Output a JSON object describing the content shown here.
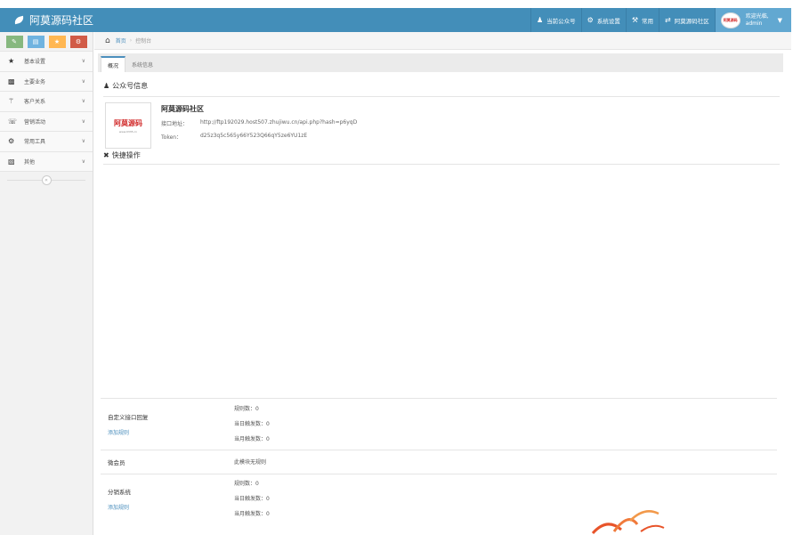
{
  "header": {
    "brand": "阿莫源码社区",
    "nav": [
      {
        "icon": "user-icon",
        "label": "当前公众号"
      },
      {
        "icon": "gear-icon",
        "label": "系统设置"
      },
      {
        "icon": "wrench-icon",
        "label": "常用"
      },
      {
        "icon": "exchange-icon",
        "label": "阿莫源码社区"
      }
    ],
    "user": {
      "greeting": "欢迎光临,",
      "name": "admin"
    }
  },
  "sidebar": {
    "shortcuts": [
      {
        "icon": "pencil-icon",
        "color": "#87b87f"
      },
      {
        "icon": "list-icon",
        "color": "#6fb3e0"
      },
      {
        "icon": "group-icon",
        "color": "#ffb752"
      },
      {
        "icon": "cog-icon",
        "color": "#d15b47"
      }
    ],
    "items": [
      {
        "icon": "star-icon",
        "label": "基本设置"
      },
      {
        "icon": "briefcase-icon",
        "label": "主要业务"
      },
      {
        "icon": "sitemap-icon",
        "label": "客户关系"
      },
      {
        "icon": "headset-icon",
        "label": "营销活动"
      },
      {
        "icon": "cog-icon",
        "label": "常用工具"
      },
      {
        "icon": "folder-open-icon",
        "label": "其他"
      }
    ]
  },
  "breadcrumb": {
    "home": "首页",
    "current": "控制台"
  },
  "tabs": [
    {
      "label": "概况",
      "active": true
    },
    {
      "label": "系统信息",
      "active": false
    }
  ],
  "account": {
    "section_title": "公众号信息",
    "logo_text": "阿莫源码",
    "logo_sub": "www.0335.cn",
    "name": "阿莫源码社区",
    "interface_label": "接口地址：",
    "interface_value": "http://ftp192029.host507.zhujiwu.cn/api.php?hash=p6yqD",
    "token_label": "Token：",
    "token_value": "d25z3q5c565y66Y523Q66qY5ze6YU1zE",
    "quick_title": "快捷操作"
  },
  "rules": [
    {
      "name": "自定义接口回复",
      "link": "添加规则",
      "stats": [
        "规则数：0",
        "当日触发数：0",
        "当月触发数：0"
      ]
    },
    {
      "name": "微会员",
      "link": "",
      "stats": [
        "此模块无规则"
      ]
    },
    {
      "name": "分销系统",
      "link": "添加规则",
      "stats": [
        "规则数：0",
        "当日触发数：0",
        "当月触发数：0"
      ]
    }
  ]
}
